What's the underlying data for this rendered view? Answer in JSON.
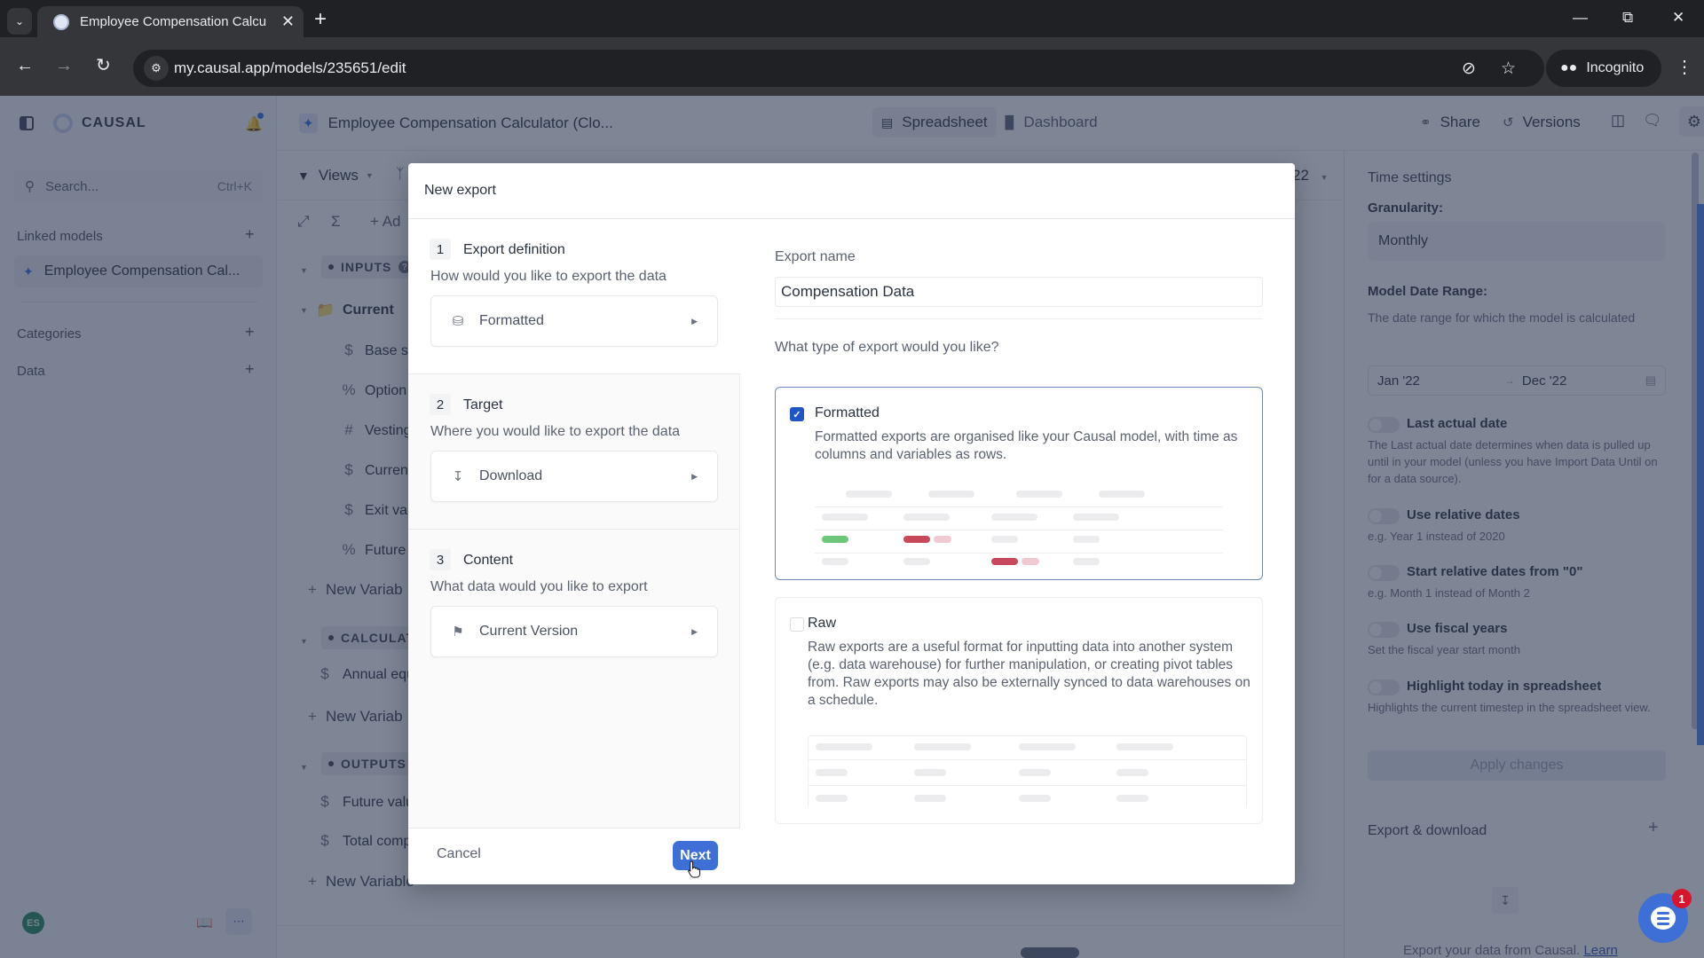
{
  "browser": {
    "tab_title": "Employee Compensation Calcu",
    "url": "my.causal.app/models/235651/edit",
    "incognito_label": "Incognito"
  },
  "sidebar": {
    "logo": "CAUSAL",
    "search_placeholder": "Search...",
    "search_shortcut": "Ctrl+K",
    "linked_models_label": "Linked models",
    "linked_model": "Employee Compensation Cal...",
    "categories_label": "Categories",
    "data_label": "Data",
    "avatar_initials": "ES"
  },
  "header": {
    "model_title": "Employee Compensation Calculator (Clo...",
    "tabs": [
      {
        "label": "Spreadsheet",
        "active": true
      },
      {
        "label": "Dashboard",
        "active": false
      }
    ],
    "share_label": "Share",
    "versions_label": "Versions"
  },
  "toolbar": {
    "views_label": "Views",
    "add_label": "Ad",
    "date_partial": "22"
  },
  "tree": {
    "groups": [
      {
        "name": "INPUTS"
      },
      {
        "name": "CALCULAT"
      },
      {
        "name": "OUTPUTS"
      }
    ],
    "folder": "Current",
    "inputs": [
      {
        "icon": "$",
        "label": "Base s"
      },
      {
        "icon": "%",
        "label": "Option"
      },
      {
        "icon": "#",
        "label": "Vesting"
      },
      {
        "icon": "$",
        "label": "Curren"
      },
      {
        "icon": "$",
        "label": "Exit va"
      },
      {
        "icon": "%",
        "label": "Future"
      }
    ],
    "calculations": [
      {
        "icon": "$",
        "label": "Annual equ"
      }
    ],
    "outputs": [
      {
        "icon": "$",
        "label": "Future valu"
      },
      {
        "icon": "$",
        "label": "Total comp"
      }
    ],
    "new_variable_label": "New Variab",
    "new_variable_label_full": "New Variable"
  },
  "settings_panel": {
    "title": "Time settings",
    "granularity_label": "Granularity:",
    "granularity_value": "Monthly",
    "date_range_label": "Model Date Range:",
    "date_range_desc": "The date range for which the model is calculated",
    "date_start": "Jan '22",
    "date_end": "Dec '22",
    "toggles": [
      {
        "label": "Last actual date",
        "desc": "The Last actual date determines when data is pulled up until in your model (unless you have Import Data Until on for a data source).",
        "on": false
      },
      {
        "label": "Use relative dates",
        "desc": "e.g. Year 1 instead of 2020",
        "on": false
      },
      {
        "label": "Start relative dates from \"0\"",
        "desc": "e.g. Month 1 instead of Month 2",
        "on": false
      },
      {
        "label": "Use fiscal years",
        "desc": "Set the fiscal year start month",
        "on": false
      },
      {
        "label": "Highlight today in spreadsheet",
        "desc": "Highlights the current timestep in the spreadsheet view.",
        "on": false
      }
    ],
    "apply_label": "Apply changes",
    "export_title": "Export & download",
    "export_desc": "Export your data from Causal.",
    "export_link": "Learn"
  },
  "chat_widget": {
    "badge_count": "1"
  },
  "modal": {
    "title": "New export",
    "steps": [
      {
        "num": "1",
        "title": "Export definition",
        "subtitle": "How would you like to export the data",
        "value": "Formatted",
        "icon": "database-icon"
      },
      {
        "num": "2",
        "title": "Target",
        "subtitle": "Where you would like to export the data",
        "value": "Download",
        "icon": "download-icon"
      },
      {
        "num": "3",
        "title": "Content",
        "subtitle": "What data would you like to export",
        "value": "Current Version",
        "icon": "flag-icon"
      }
    ],
    "cancel_label": "Cancel",
    "next_label": "Next",
    "export_name_label": "Export name",
    "export_name_value": "Compensation Data",
    "type_question": "What type of export would you like?",
    "options": [
      {
        "title": "Formatted",
        "desc": "Formatted exports are organised like your Causal model, with time as columns and variables as rows.",
        "checked": true
      },
      {
        "title": "Raw",
        "desc": "Raw exports are a useful format for inputting data into another system (e.g. data warehouse) for further manipulation, or creating pivot tables from. Raw exports may also be externally synced to data warehouses on a schedule.",
        "checked": false
      }
    ],
    "preview_colors": {
      "positive": "#6cc77a",
      "negative": "#c9485b",
      "negative_light": "#f1c9d1"
    }
  }
}
